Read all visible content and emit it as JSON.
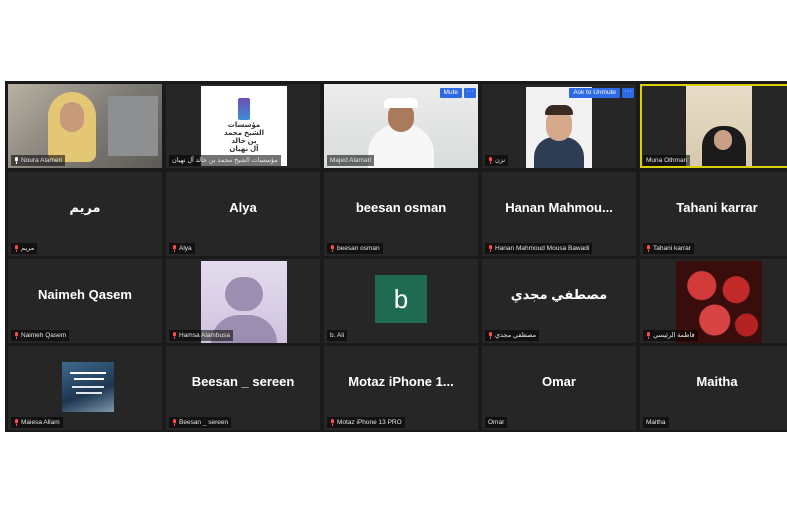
{
  "meeting": {
    "mute_label": "Mute",
    "ask_unmute_label": "Ask to Unmute",
    "more_label": "···",
    "tiles": [
      {
        "display": "",
        "label": "Noura Alameri",
        "type": "photo",
        "muted": true
      },
      {
        "display": "",
        "label": "مؤسسات الشيخ محمد بن خالد آل نهيان",
        "type": "logo",
        "muted": false,
        "logo_text": [
          "مؤسسات",
          "الشيخ محمد",
          "بن خالد",
          "آل نهيان"
        ]
      },
      {
        "display": "",
        "label": "Majed Alamari",
        "type": "photo",
        "muted": false
      },
      {
        "display": "",
        "label": "نزن",
        "type": "photo",
        "muted": true
      },
      {
        "display": "",
        "label": "Muna Othman",
        "type": "photo",
        "muted": false
      },
      {
        "display": "مريم",
        "label": "مريم",
        "type": "name",
        "muted": true
      },
      {
        "display": "Alya",
        "label": "Alya",
        "type": "name",
        "muted": true
      },
      {
        "display": "beesan osman",
        "label": "beesan osman",
        "type": "name",
        "muted": true
      },
      {
        "display": "Hanan Mahmou...",
        "label": "Hanan Mahmoud Mousa Bawadi",
        "type": "name",
        "muted": true
      },
      {
        "display": "Tahani karrar",
        "label": "Tahani karrar",
        "type": "name",
        "muted": true
      },
      {
        "display": "Naimeh Qasem",
        "label": "Naimeh Qasem",
        "type": "name",
        "muted": true
      },
      {
        "display": "",
        "label": "Hamsa Alambusa",
        "type": "avatar",
        "muted": true
      },
      {
        "display": "b",
        "label": "b. Ali",
        "type": "initial",
        "muted": false
      },
      {
        "display": "مصطفي مجدي",
        "label": "مصطفي مجدي",
        "type": "name",
        "muted": true
      },
      {
        "display": "",
        "label": "فاطمة الرئيسي",
        "type": "roses",
        "muted": true
      },
      {
        "display": "",
        "label": "Maiesa Allam",
        "type": "poster",
        "muted": true
      },
      {
        "display": "Beesan _ sereen",
        "label": "Beesan _ sereen",
        "type": "name",
        "muted": true
      },
      {
        "display": "Motaz iPhone 1...",
        "label": "Motaz iPhone 13 PRO",
        "type": "name",
        "muted": true
      },
      {
        "display": "Omar",
        "label": "Omar",
        "type": "name",
        "muted": false
      },
      {
        "display": "Maitha",
        "label": "Maitha",
        "type": "name",
        "muted": false
      }
    ]
  },
  "colors": {
    "active_border": "#d8d000",
    "tile_bg": "#262626",
    "muted_icon": "#ff4a4a",
    "button_blue": "#2d6be4",
    "initial_bg": "#1e6b52"
  }
}
